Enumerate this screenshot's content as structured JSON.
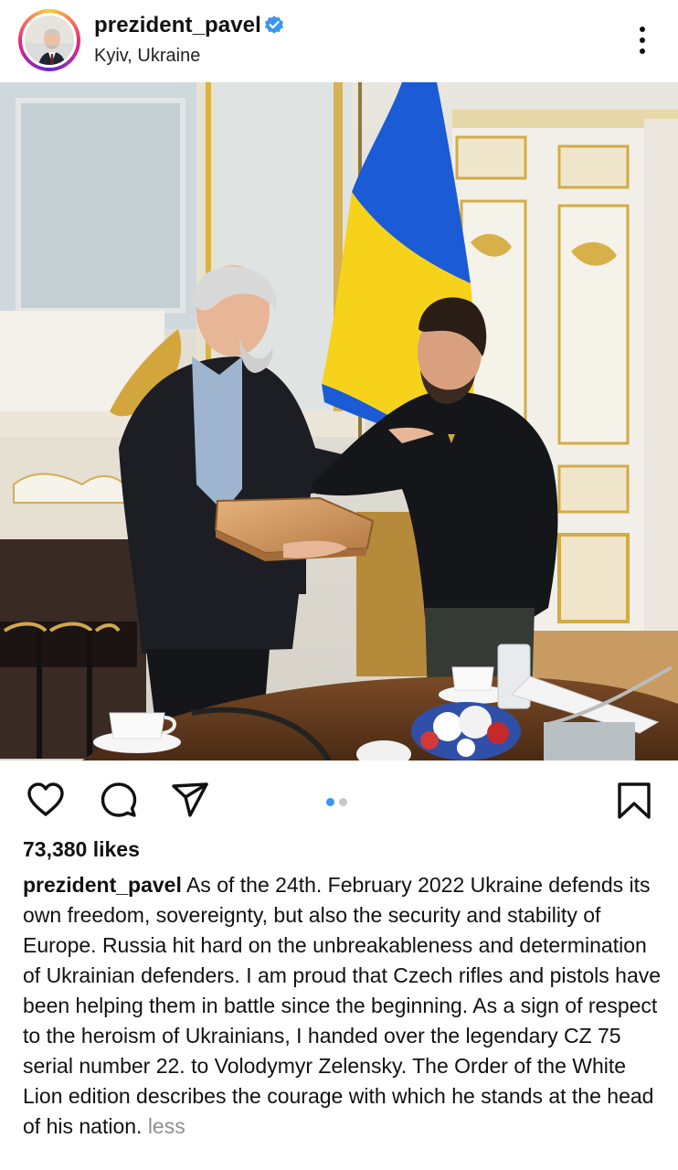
{
  "post": {
    "username": "prezident_pavel",
    "location": "Kyiv, Ukraine",
    "verified": true,
    "likes": "73,380 likes",
    "caption_user": "prezident_pavel",
    "caption_text": "As of the 24th. February 2022 Ukraine defends its own freedom, sovereignty, but also the security and stability of Europe. Russia hit hard on the unbreakableness and determination of Ukrainian defenders. I am proud that Czech rifles and pistols have been helping them in battle since the beginning. As a sign of respect to the heroism of Ukrainians, I handed over the legendary CZ 75 serial number 22. to Volodymyr Zelensky. The Order of the White Lion edition describes the courage with which he stands at the head of his nation.",
    "less_label": "less",
    "carousel_current": 1,
    "carousel_total": 2
  },
  "icons": {
    "more": "more-vertical-icon",
    "like": "heart-icon",
    "comment": "comment-icon",
    "share": "paper-plane-icon",
    "save": "bookmark-icon",
    "verified": "verified-badge-icon"
  },
  "colors": {
    "verified": "#3897f0",
    "active_dot": "#3897f0",
    "flag_blue": "#1b5bd6",
    "flag_yellow": "#f7d21b"
  }
}
